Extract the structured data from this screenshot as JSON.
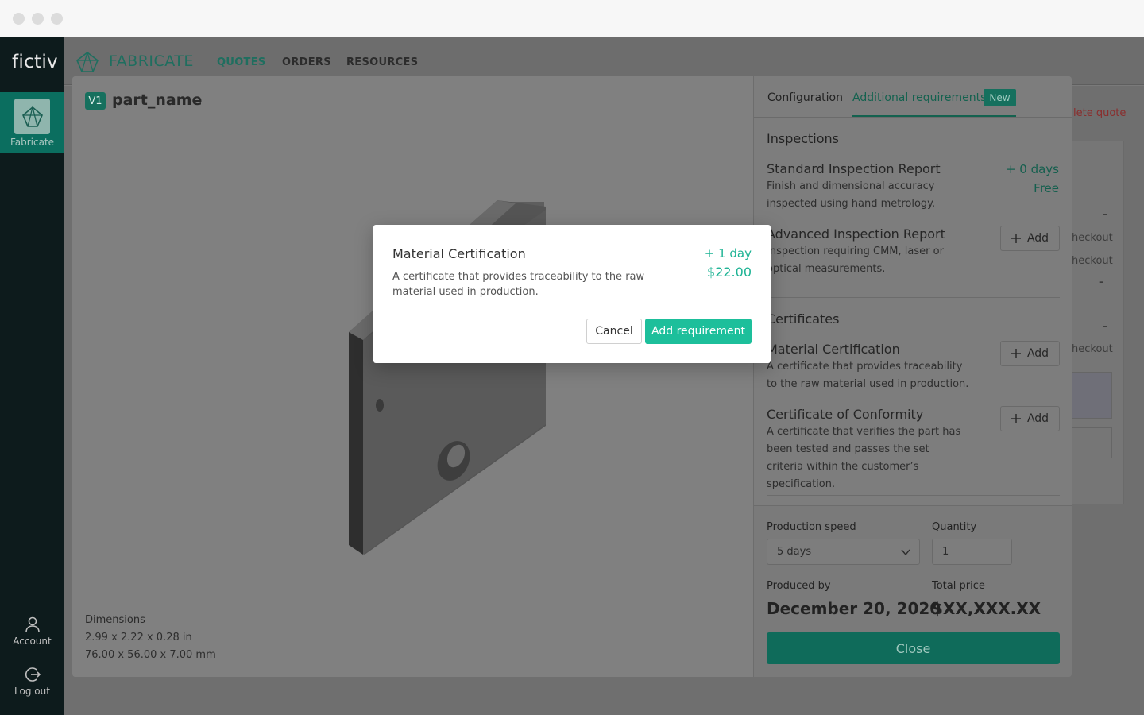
{
  "app": {
    "logo": "fictiv",
    "brand": "FABRICATE"
  },
  "sidebar": {
    "fabricate_label": "Fabricate",
    "account_label": "Account",
    "logout_label": "Log out"
  },
  "nav": {
    "quotes": "QUOTES",
    "orders": "ORDERS",
    "resources": "RESOURCES"
  },
  "background": {
    "delete_quote": "lete quote",
    "checkout_1": "heckout",
    "checkout_2": "heckout",
    "checkout_3": "heckout",
    "dash": "–"
  },
  "viewer": {
    "version": "V1",
    "part_name": "part_name",
    "dimensions_label": "Dimensions",
    "dimensions_in": "2.99 x 2.22 x 0.28 in",
    "dimensions_mm": "76.00 x 56.00 x 7.00 mm"
  },
  "panel": {
    "tabs": [
      {
        "label": "Configuration"
      },
      {
        "label": "Additional requirements",
        "badge": "New"
      }
    ],
    "inspections_title": "Inspections",
    "inspections": [
      {
        "title": "Standard Inspection Report",
        "desc": "Finish and dimensional accuracy inspected using hand metrology.",
        "days": "+ 0 days",
        "price": "Free"
      },
      {
        "title": "Advanced Inspection Report",
        "desc": "Inspection requiring CMM, laser or optical measurements.",
        "add_label": "Add"
      }
    ],
    "certificates_title": "Certificates",
    "certificates": [
      {
        "title": "Material Certification",
        "desc": "A certificate that provides traceability to the raw material used in production.",
        "add_label": "Add"
      },
      {
        "title": "Certificate of Conformity",
        "desc": "A certificate that verifies the part has been tested and passes the set criteria within the customer’s specification.",
        "add_label": "Add"
      }
    ],
    "footer": {
      "speed_label": "Production speed",
      "speed_value": "5 days",
      "quantity_label": "Quantity",
      "quantity_value": "1",
      "produced_by_label": "Produced by",
      "produced_by_value": "December 20, 2020",
      "total_price_label": "Total price",
      "total_price_value": "$XX,XXX.XX",
      "close_label": "Close"
    }
  },
  "dialog": {
    "title": "Material Certification",
    "desc": "A certificate that provides traceability to the raw material used in production.",
    "days": "+ 1 day",
    "price": "$22.00",
    "cancel_label": "Cancel",
    "add_label": "Add requirement"
  },
  "colors": {
    "accent": "#1dbf9b",
    "dialog_price": "#1db394",
    "sidebar_bg": "#0d1b1c"
  }
}
